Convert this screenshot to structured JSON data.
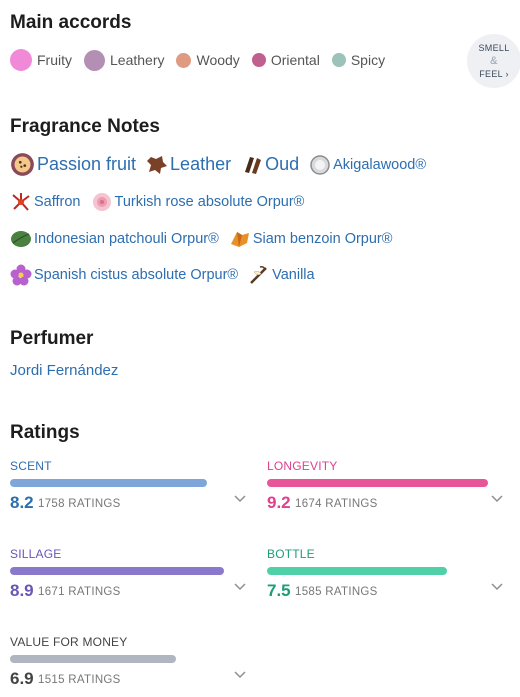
{
  "sections": {
    "accords_title": "Main accords",
    "notes_title": "Fragrance Notes",
    "perfumer_title": "Perfumer",
    "ratings_title": "Ratings"
  },
  "smell_feel": {
    "line1": "SMELL",
    "amp": "&",
    "line2": "FEEL"
  },
  "accords": [
    {
      "label": "Fruity",
      "color": "#f08ad8"
    },
    {
      "label": "Leathery",
      "color": "#b48fb4"
    },
    {
      "label": "Woody",
      "color": "#e09a82"
    },
    {
      "label": "Oriental",
      "color": "#c0608e"
    },
    {
      "label": "Spicy",
      "color": "#9cc2ba"
    }
  ],
  "notes": [
    {
      "label": "Passion fruit",
      "icon": "passion-fruit-icon"
    },
    {
      "label": "Leather",
      "icon": "leather-icon"
    },
    {
      "label": "Oud",
      "icon": "oud-icon"
    },
    {
      "label": "Akigalawood®",
      "icon": "akigalawood-icon"
    },
    {
      "label": "Saffron",
      "icon": "saffron-icon"
    },
    {
      "label": "Turkish rose absolute Orpur®",
      "icon": "rose-icon"
    },
    {
      "label": "Indonesian patchouli Orpur®",
      "icon": "patchouli-icon"
    },
    {
      "label": "Siam benzoin Orpur®",
      "icon": "benzoin-icon"
    },
    {
      "label": "Spanish cistus absolute Orpur®",
      "icon": "cistus-icon"
    },
    {
      "label": "Vanilla",
      "icon": "vanilla-icon"
    }
  ],
  "perfumer": {
    "name": "Jordi Fernández"
  },
  "ratings": [
    {
      "label": "SCENT",
      "score": "8.2",
      "count": "1758 RATINGS",
      "fraction": 0.82,
      "color": "#7ea6d8",
      "text_color": "#2d6eb0"
    },
    {
      "label": "LONGEVITY",
      "score": "9.2",
      "count": "1674 RATINGS",
      "fraction": 0.92,
      "color": "#e8569a",
      "text_color": "#e0408c"
    },
    {
      "label": "SILLAGE",
      "score": "8.9",
      "count": "1671 RATINGS",
      "fraction": 0.89,
      "color": "#8a78cc",
      "text_color": "#6a55b8"
    },
    {
      "label": "BOTTLE",
      "score": "7.5",
      "count": "1585 RATINGS",
      "fraction": 0.75,
      "color": "#4fd0a6",
      "text_color": "#1f9c78"
    },
    {
      "label": "VALUE FOR MONEY",
      "score": "6.9",
      "count": "1515 RATINGS",
      "fraction": 0.69,
      "color": "#b0b6c0",
      "text_color": "#444"
    }
  ]
}
